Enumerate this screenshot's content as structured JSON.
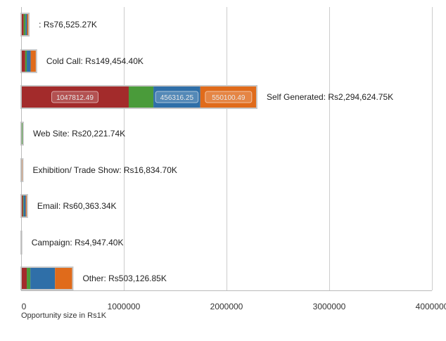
{
  "chart_data": {
    "type": "bar",
    "orientation": "horizontal",
    "stacked": true,
    "xlabel": "Opportunity size in Rs1K",
    "xlim": [
      0,
      4000000
    ],
    "x_ticks": [
      "0",
      "1000000",
      "2000000",
      "3000000",
      "4000000"
    ],
    "x_tick_values": [
      0,
      1000000,
      2000000,
      3000000,
      4000000
    ],
    "grid": true,
    "categories": [
      ": Rs76,525.27K",
      "Cold Call: Rs149,454.40K",
      "Self Generated: Rs2,294,624.75K",
      "Web Site: Rs20,221.74K",
      "Exhibition/ Trade Show: Rs16,834.70K",
      "Email: Rs60,363.34K",
      "Campaign: Rs4,947.40K",
      "Other: Rs503,126.85K"
    ],
    "series": [
      {
        "color": "#a32b2b",
        "values": [
          25000,
          40000,
          1047812.49,
          3000,
          3500,
          18000,
          1500,
          55000
        ],
        "labels": [
          "",
          "",
          "1047812.49",
          "",
          "",
          "",
          "",
          ""
        ]
      },
      {
        "color": "#4a9b3a",
        "values": [
          18000,
          15000,
          240395.52,
          13000,
          1000,
          7000,
          2000,
          35000
        ],
        "labels": [
          "",
          "",
          "",
          "",
          "",
          "",
          "",
          ""
        ]
      },
      {
        "color": "#2f6fa8",
        "values": [
          15000,
          38000,
          456316.25,
          3000,
          2000,
          20000,
          1000,
          240000
        ],
        "labels": [
          "",
          "",
          "456316.25",
          "",
          "",
          "",
          "",
          ""
        ]
      },
      {
        "color": "#e06b1b",
        "values": [
          18525.27,
          56454.4,
          550100.49,
          1221.74,
          10334.7,
          15363.34,
          447.4,
          173126.85
        ],
        "labels": [
          "",
          "",
          "550100.49",
          "",
          "",
          "",
          "",
          ""
        ]
      }
    ]
  }
}
